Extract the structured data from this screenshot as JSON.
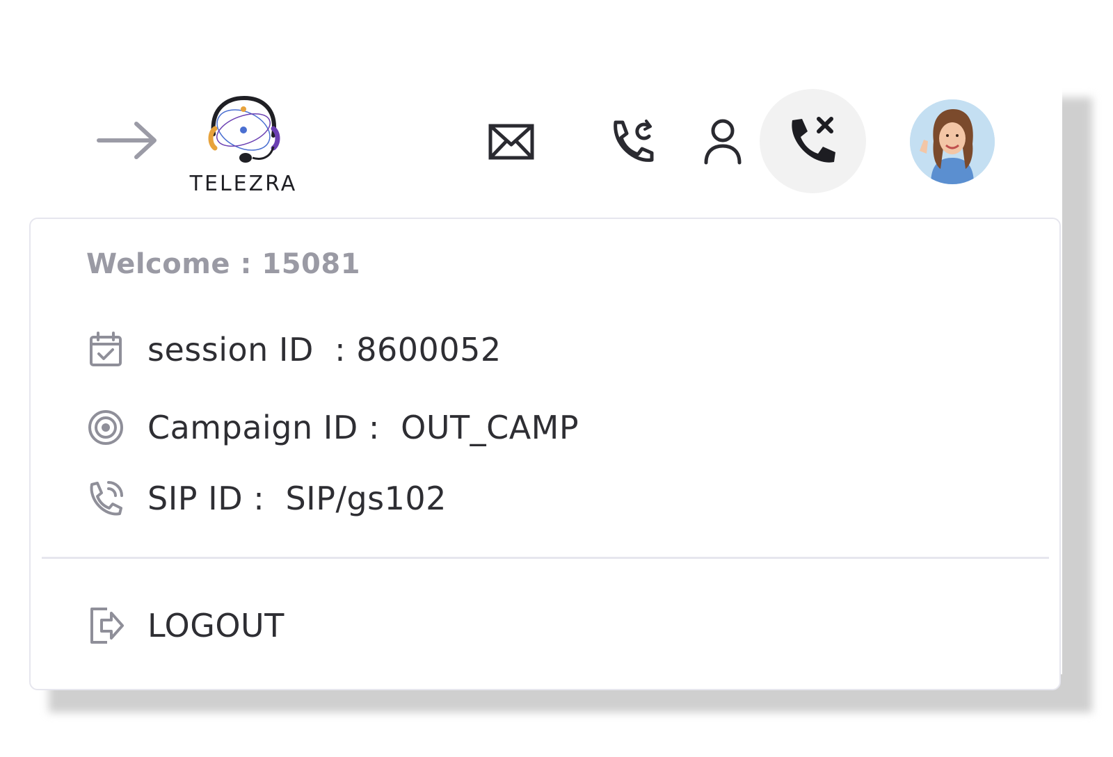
{
  "header": {
    "logo_text": "TELEZRA",
    "icons": {
      "expand": "arrow-right-icon",
      "mail": "mail-icon",
      "callback": "phone-callback-icon",
      "user": "user-icon",
      "hangup": "phone-hangup-icon"
    }
  },
  "profile_menu": {
    "welcome": "Welcome : 15081",
    "rows": [
      {
        "icon": "calendar-check-icon",
        "text": "session ID  : 8600052"
      },
      {
        "icon": "target-icon",
        "text": "Campaign ID :  OUT_CAMP"
      },
      {
        "icon": "phone-ringing-icon",
        "text": "SIP ID :  SIP/gs102"
      }
    ],
    "logout_label": "LOGOUT"
  },
  "colors": {
    "text_primary": "#2e2e33",
    "text_muted": "#9a9aa4",
    "icon_gray": "#8f8f99",
    "border": "#e6e6ee",
    "hangup_bg": "#f2f2f2",
    "logo_orange": "#e7a23b",
    "logo_purple": "#6b3fb2",
    "logo_blue": "#4a6fd1"
  }
}
